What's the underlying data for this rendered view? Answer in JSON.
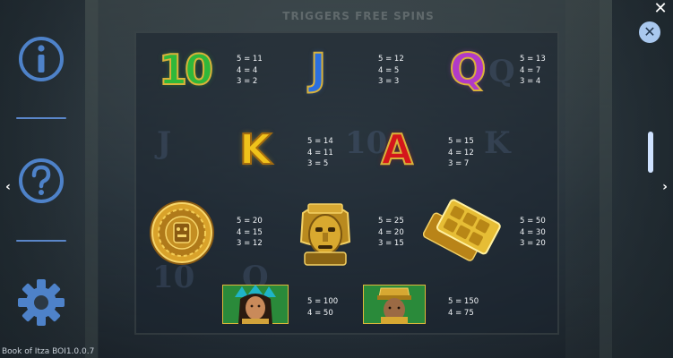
{
  "banner": {
    "text": "TRIGGERS FREE SPINS"
  },
  "menu": {
    "info_icon": "info-icon",
    "help_icon": "question-icon",
    "settings_icon": "gear-icon"
  },
  "controls": {
    "close_glyph": "✕",
    "close_circle_glyph": "✕",
    "arrow_left": "‹",
    "arrow_right": "›"
  },
  "paytable": [
    {
      "symbol": "10",
      "lines": [
        "5 = 11",
        "4 = 4",
        "3 = 2"
      ]
    },
    {
      "symbol": "J",
      "lines": [
        "5 = 12",
        "4 = 5",
        "3 = 3"
      ]
    },
    {
      "symbol": "Q",
      "lines": [
        "5 = 13",
        "4 = 7",
        "3 = 4"
      ]
    },
    {
      "symbol": "K",
      "lines": [
        "5 = 14",
        "4 = 11",
        "3 = 5"
      ]
    },
    {
      "symbol": "A",
      "lines": [
        "5 = 15",
        "4 = 12",
        "3 = 7"
      ]
    },
    {
      "symbol": "calendar-disc",
      "lines": [
        "5 = 20",
        "4 = 15",
        "3 = 12"
      ]
    },
    {
      "symbol": "golden-mask",
      "lines": [
        "5 = 25",
        "4 = 20",
        "3 = 15"
      ]
    },
    {
      "symbol": "golden-tablets",
      "lines": [
        "5 = 50",
        "4 = 30",
        "3 = 20"
      ]
    },
    {
      "symbol": "priestess",
      "lines": [
        "5 = 100",
        "4 = 50"
      ]
    },
    {
      "symbol": "warrior",
      "lines": [
        "5 = 150",
        "4 = 75"
      ]
    }
  ],
  "colors": {
    "ten": "#2fb83a",
    "jack": "#2a6fe0",
    "queen": "#b13ac9",
    "king": "#f0c21b",
    "ace": "#d4161b",
    "menu_icon": "#4e82c9"
  },
  "footer": {
    "version": "Book of Itza BOI1.0.0.7"
  }
}
